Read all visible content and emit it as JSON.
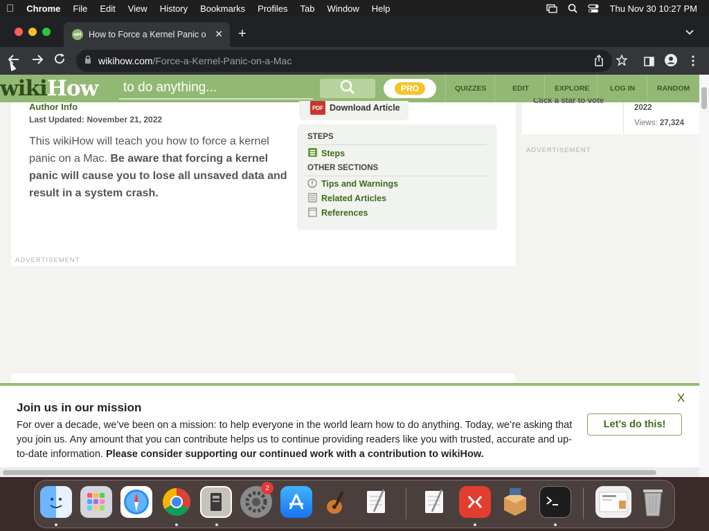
{
  "menubar": {
    "apple": "",
    "items": [
      "Chrome",
      "File",
      "Edit",
      "View",
      "History",
      "Bookmarks",
      "Profiles",
      "Tab",
      "Window",
      "Help"
    ],
    "clock": "Thu Nov 30  10:27 PM"
  },
  "tab": {
    "title": "How to Force a Kernel Panic on a Mac",
    "favicon_text": "wH",
    "close": "✕",
    "new_tab": "+",
    "dropdown": "⌄"
  },
  "toolbar": {
    "url_host": "wikihow.com",
    "url_path": "/Force-a-Kernel-Panic-on-a-Mac"
  },
  "site": {
    "logo_wiki": "wiki",
    "logo_how": "How",
    "search_placeholder": "to do anything...",
    "pro_label": "PRO",
    "nav": [
      "QUIZZES",
      "EDIT",
      "EXPLORE",
      "LOG IN",
      "RANDOM"
    ]
  },
  "article": {
    "author_info": "Author Info",
    "last_updated": "Last Updated: November 21, 2022",
    "intro_plain": "This wikiHow will teach you how to force a kernel panic on a Mac. ",
    "intro_bold": "Be aware that forcing a kernel panic will cause you to lose all unsaved data and result in a system crash.",
    "download_label": "Download Article",
    "pdf_label": "PDF",
    "toc": {
      "steps_heading": "STEPS",
      "steps_item": "Steps",
      "other_heading": "OTHER SECTIONS",
      "other_items": [
        "Tips and Warnings",
        "Related Articles",
        "References"
      ]
    },
    "ad_label": "ADVERTISEMENT"
  },
  "sidebar": {
    "vote_text": "Click a star to vote",
    "updated_year": "2022",
    "views_label": "Views:",
    "views_count": "27,324",
    "ad_label": "ADVERTISEMENT"
  },
  "banner": {
    "title": "Join us in our mission",
    "text_plain": "For over a decade, we’ve been on a mission: to help everyone in the world learn how to do anything. Today, we’re asking that you join us. Any amount that you can contribute helps us to continue providing readers like you with trusted, accurate and up-to-date information. ",
    "text_bold": "Please consider supporting our continued work with a contribution to wikiHow.",
    "button": "Let’s do this!",
    "close": "X"
  },
  "dock": {
    "badge_count": "2"
  },
  "colors": {
    "brand_green": "#93b874",
    "link_green": "#3e6a1c"
  }
}
